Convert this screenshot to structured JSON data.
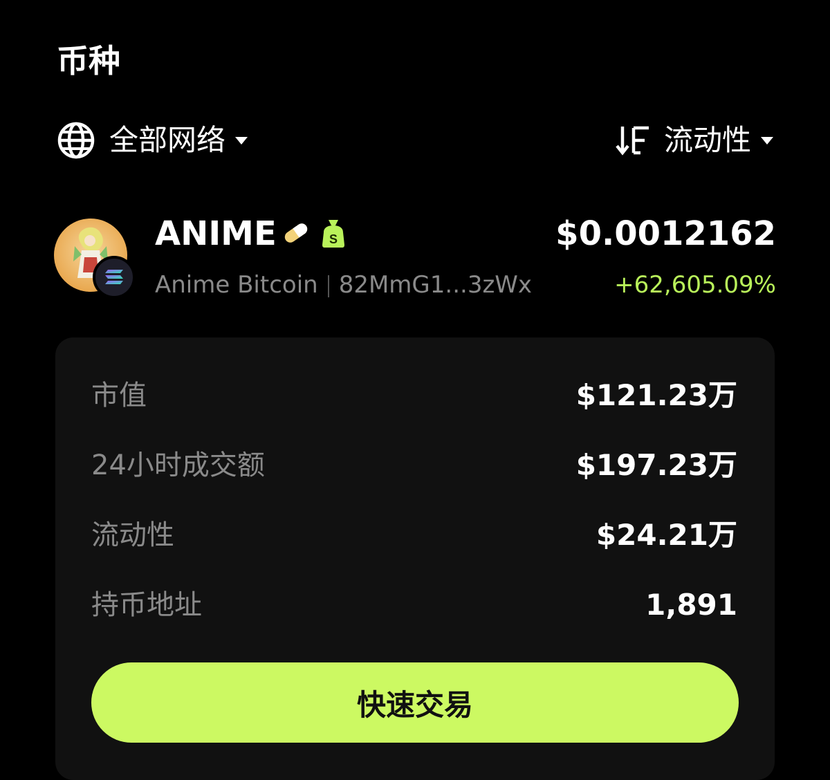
{
  "section": {
    "title": "币种"
  },
  "filters": {
    "network": {
      "label": "全部网络",
      "icon": "globe-icon"
    },
    "sort": {
      "label": "流动性",
      "icon": "sort-icon"
    }
  },
  "token": {
    "symbol": "ANIME",
    "name": "Anime Bitcoin",
    "address": "82MmG1...3zWx",
    "price": "$0.0012162",
    "change": "+62,605.09%",
    "tags": [
      "pill-icon",
      "money-bag-icon"
    ],
    "chain_icon": "solana-icon"
  },
  "stats": [
    {
      "label": "市值",
      "value": "$121.23万"
    },
    {
      "label": "24小时成交额",
      "value": "$197.23万"
    },
    {
      "label": "流动性",
      "value": "$24.21万"
    },
    {
      "label": "持币地址",
      "value": "1,891"
    }
  ],
  "actions": {
    "trade_label": "快速交易"
  },
  "colors": {
    "accent": "#ccf962",
    "positive": "#b9f25a",
    "card_bg": "#111111",
    "muted_text": "#8a8a8a"
  }
}
